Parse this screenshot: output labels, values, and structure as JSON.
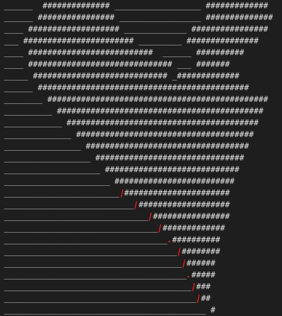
{
  "lines": [
    "______  ############## __________________ #############",
    "______ ################ _________________ ##############",
    "____ ################### _____________ ################",
    "___ ####################### _________ ###############",
    "____ ##########################  ______ ##########",
    "____ ############################## ___ #######",
    "_____ ############################ _#############",
    "______ ############################################",
    "________ ##############################################",
    "__________ ###########################################",
    "____________ ########################################",
    "______________ #####################################",
    "________________ ##################################",
    "__________________ ###############################",
    "____________________ ############################",
    "______________________ #########################",
    "________________________ ######################",
    "___________________________ ###################",
    "______________________________ ################",
    "________________________________ #############",
    "__________________________________ ##########",
    "____________________________________ ########",
    "_____________________________________ ######",
    "______________________________________ #####",
    "_______________________________________ ###",
    "________________________________________ ##",
    "__________________________________________ #"
  ],
  "red_marks": [
    {
      "row": 16,
      "glyph": "|"
    },
    {
      "row": 17,
      "glyph": "|"
    },
    {
      "row": 18,
      "glyph": "|"
    },
    {
      "row": 19,
      "glyph": "|"
    },
    {
      "row": 20,
      "glyph": "."
    },
    {
      "row": 21,
      "glyph": "|"
    },
    {
      "row": 22,
      "glyph": "|"
    },
    {
      "row": 23,
      "glyph": "."
    },
    {
      "row": 24,
      "glyph": "|"
    },
    {
      "row": 25,
      "glyph": "|"
    }
  ]
}
